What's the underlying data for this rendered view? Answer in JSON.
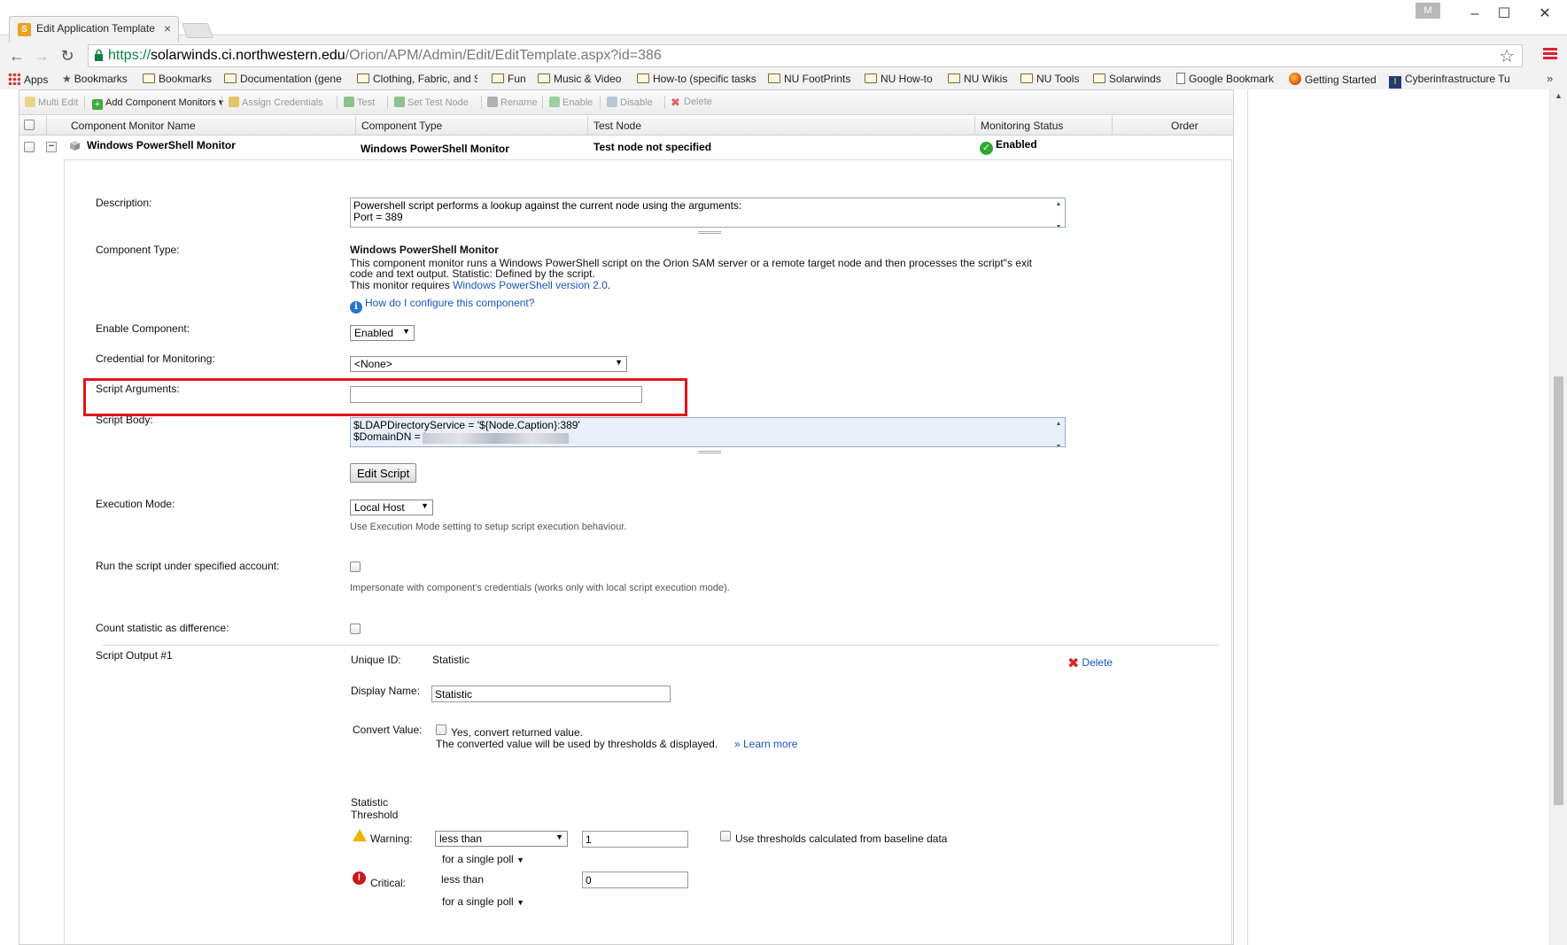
{
  "browser": {
    "tab_title": "Edit Application Template",
    "url_scheme": "https://",
    "url_domain": "solarwinds.ci.northwestern.edu",
    "url_path": "/Orion/APM/Admin/Edit/EditTemplate.aspx?id=386",
    "user_badge": "M"
  },
  "bookmarks": [
    {
      "label": "Apps",
      "icon": "apps-grid-icon"
    },
    {
      "label": "Bookmarks",
      "icon": "star-icon"
    },
    {
      "label": "Bookmarks",
      "icon": "folder-icon"
    },
    {
      "label": "Documentation (gene",
      "icon": "folder-icon"
    },
    {
      "label": "Clothing, Fabric, and S",
      "icon": "folder-icon"
    },
    {
      "label": "Fun",
      "icon": "folder-icon"
    },
    {
      "label": "Music & Video",
      "icon": "folder-icon"
    },
    {
      "label": "How-to (specific tasks",
      "icon": "folder-icon"
    },
    {
      "label": "NU FootPrints",
      "icon": "folder-icon"
    },
    {
      "label": "NU How-to",
      "icon": "folder-icon"
    },
    {
      "label": "NU Wikis",
      "icon": "folder-icon"
    },
    {
      "label": "NU Tools",
      "icon": "folder-icon"
    },
    {
      "label": "Solarwinds",
      "icon": "folder-icon"
    },
    {
      "label": "Google Bookmark",
      "icon": "page-icon"
    },
    {
      "label": "Getting Started",
      "icon": "firefox-icon"
    },
    {
      "label": "Cyberinfrastructure Tu",
      "icon": "ci-logo-icon"
    }
  ],
  "toolbar": {
    "multi_edit": "Multi Edit",
    "add_component_monitors": "Add Component Monitors",
    "assign_credentials": "Assign Credentials",
    "test": "Test",
    "set_test_node": "Set Test Node",
    "rename": "Rename",
    "enable": "Enable",
    "disable": "Disable",
    "delete": "Delete"
  },
  "grid": {
    "columns": [
      "Component Monitor Name",
      "Component Type",
      "Test Node",
      "Monitoring Status",
      "Order"
    ],
    "row": {
      "name": "Windows PowerShell Monitor",
      "type": "Windows PowerShell Monitor",
      "test_node": "Test node not specified",
      "status": "Enabled"
    }
  },
  "detail": {
    "description_label": "Description:",
    "description_line1": "Powershell script performs a lookup against the current node using the arguments:",
    "description_line2": "Port = 389",
    "component_type_label": "Component Type:",
    "component_type_title": "Windows PowerShell Monitor",
    "component_type_desc": "This component monitor runs a Windows PowerShell script on the Orion SAM server or a remote target node and then processes the script\"s exit code and text output. Statistic: Defined by the script.",
    "requires_prefix": "This monitor requires",
    "requires_link": "Windows PowerShell version 2.0",
    "requires_suffix": ".",
    "howto_link": "How do I configure this component?",
    "enable_label": "Enable Component:",
    "enable_value": "Enabled",
    "credential_label": "Credential for Monitoring:",
    "credential_value": "<None>",
    "script_args_label": "Script Arguments:",
    "script_args_value": "",
    "script_body_label": "Script Body:",
    "script_body_line1": "$LDAPDirectoryService = '${Node.Caption}:389'",
    "script_body_line2": "$DomainDN = '",
    "edit_script_button": "Edit Script",
    "exec_mode_label": "Execution Mode:",
    "exec_mode_value": "Local Host",
    "exec_mode_hint": "Use Execution Mode setting to setup script execution behaviour.",
    "run_as_label": "Run the script under specified account:",
    "run_as_hint": "Impersonate with component's credentials (works only with local script execution mode).",
    "count_diff_label": "Count statistic as difference:",
    "output_label": "Script Output #1",
    "unique_id_label": "Unique ID:",
    "unique_id_value": "Statistic",
    "delete_link": "Delete",
    "display_name_label": "Display Name:",
    "display_name_value": "Statistic",
    "convert_label": "Convert Value:",
    "convert_checkbox": "Yes, convert returned value.",
    "convert_hint": "The converted value will be used by thresholds & displayed.",
    "learn_more": "» Learn more",
    "threshold_label_1": "Statistic",
    "threshold_label_2": "Threshold",
    "warning_label": "Warning:",
    "warning_op": "less than",
    "warning_value": "1",
    "baseline_label": "Use thresholds calculated from baseline data",
    "warning_poll": "for a single poll",
    "critical_label": "Critical:",
    "critical_op": "less than",
    "critical_value": "0",
    "critical_poll": "for a single poll"
  },
  "colors": {
    "highlight_box": "#e3141b",
    "link": "#1a55c4",
    "enabled_green": "#2fa62f"
  }
}
